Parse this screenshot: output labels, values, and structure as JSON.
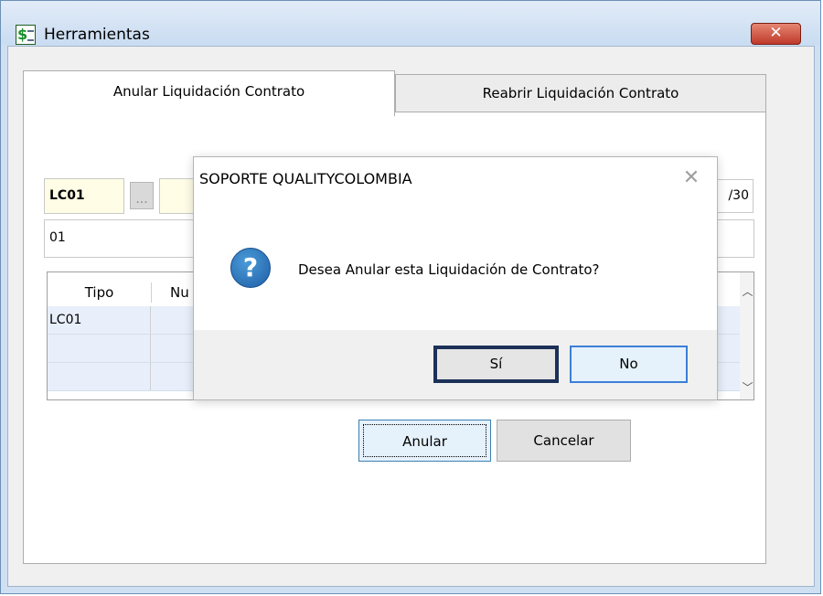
{
  "window": {
    "title": "Herramientas",
    "close_glyph": "✕",
    "icon": "spreadsheet-dollar-icon"
  },
  "tabs": [
    {
      "label": "Anular Liquidación Contrato",
      "active": true
    },
    {
      "label": "Reabrir Liquidación Contrato",
      "active": false
    }
  ],
  "form": {
    "code_value": "LC01",
    "lookup_button_label": "...",
    "description_value": "",
    "date_partial": "/30",
    "second_field_value": "01"
  },
  "grid": {
    "columns": [
      "Tipo",
      "Nu"
    ],
    "rows": [
      {
        "tipo": "LC01"
      },
      {
        "tipo": ""
      },
      {
        "tipo": ""
      }
    ]
  },
  "buttons": {
    "anular": "Anular",
    "cancelar": "Cancelar"
  },
  "dialog": {
    "title": "SOPORTE QUALITYCOLOMBIA",
    "close_glyph": "✕",
    "icon": "question-icon",
    "icon_glyph": "?",
    "message": "Desea Anular esta Liquidación de Contrato?",
    "yes_label": "Sí",
    "no_label": "No"
  },
  "colors": {
    "accent": "#3c7fd8",
    "selected_button_border": "#1c3158",
    "close_button": "#c0392b"
  }
}
